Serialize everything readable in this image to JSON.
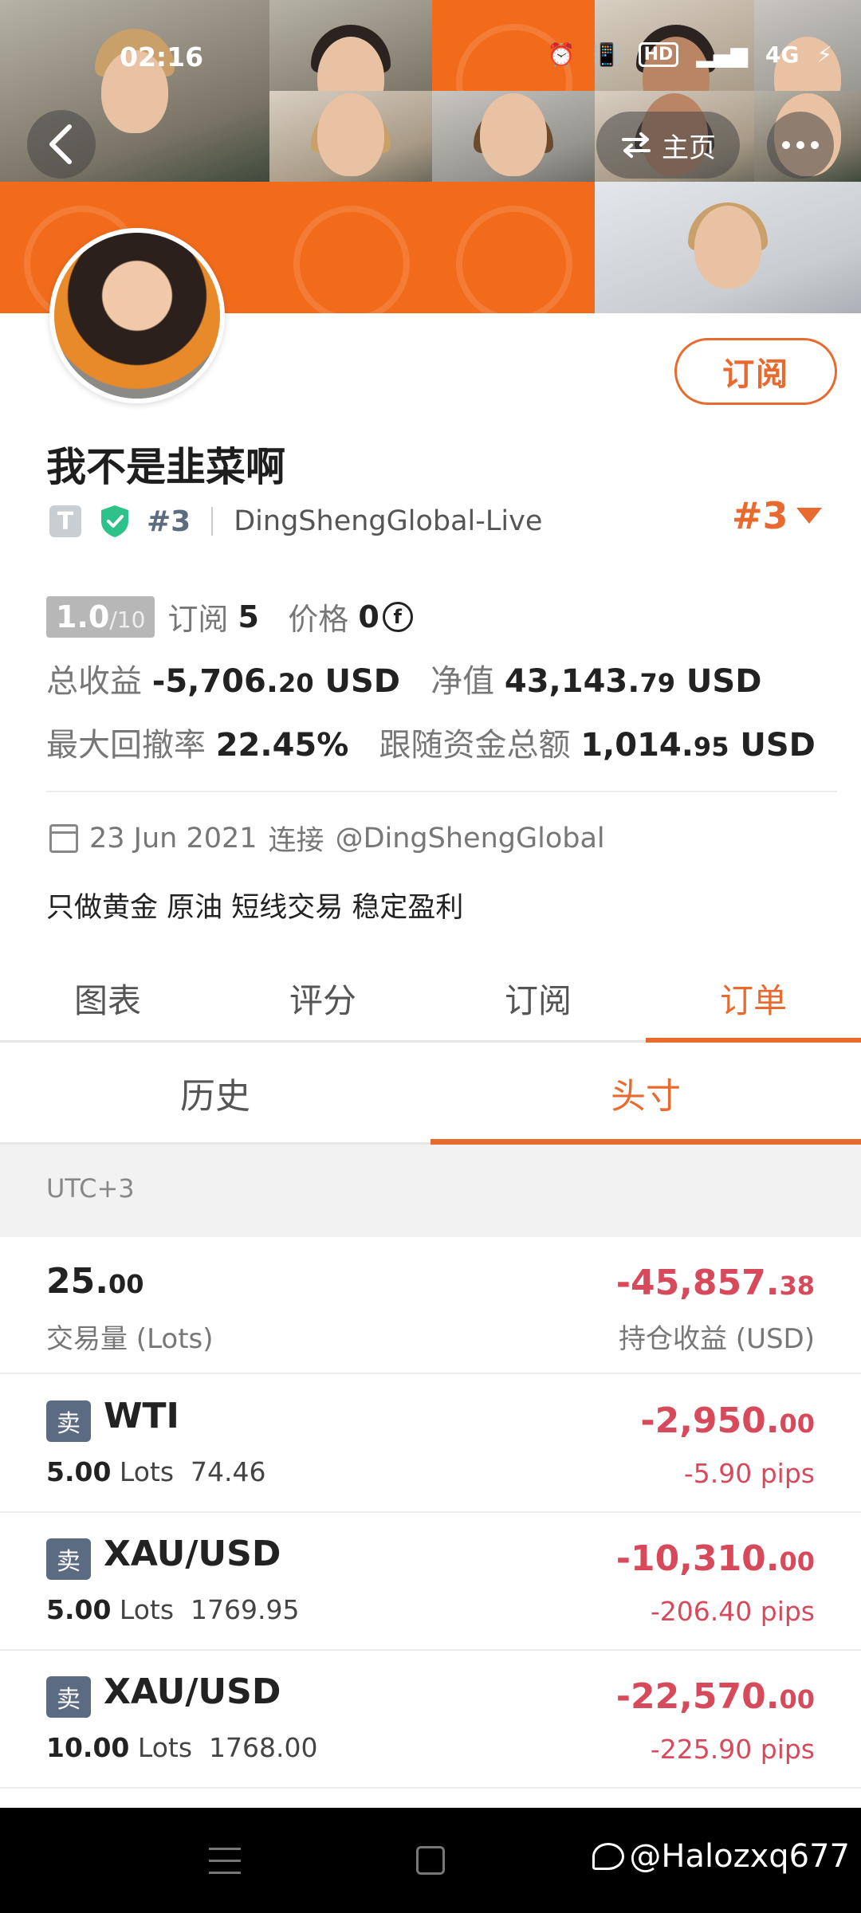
{
  "status_bar": {
    "time": "02:16",
    "network": "4G"
  },
  "header": {
    "home_label": "主页"
  },
  "profile": {
    "subscribe_label": "订阅",
    "name": "我不是韭菜啊",
    "badge_letter": "T",
    "rank": "#3",
    "broker": "DingShengGlobal-Live",
    "rank_right": "#3",
    "score": "1.0",
    "score_max": "/10",
    "subs_label": "订阅",
    "subs_value": "5",
    "price_label": "价格",
    "price_value": "0",
    "total_profit_label": "总收益",
    "total_profit_main": "-5,706.",
    "total_profit_dec": "20",
    "usd": "USD",
    "equity_label": "净值",
    "equity_main": "43,143.",
    "equity_dec": "79",
    "max_dd_label": "最大回撤率",
    "max_dd_value": "22.45%",
    "follow_label": "跟随资金总额",
    "follow_main": "1,014.",
    "follow_dec": "95",
    "connect_date": "23 Jun 2021",
    "connect_label": "连接",
    "connect_account": "@DingShengGlobal",
    "bio": "只做黄金 原油 短线交易 稳定盈利"
  },
  "tabs": [
    "图表",
    "评分",
    "订阅",
    "订单"
  ],
  "subtabs": [
    "历史",
    "头寸"
  ],
  "timezone": "UTC+3",
  "summary": {
    "volume_main": "25.",
    "volume_dec": "00",
    "volume_label": "交易量 (Lots)",
    "pnl_main": "-45,857.",
    "pnl_dec": "38",
    "pnl_label": "持仓收益 (USD)"
  },
  "orders": [
    {
      "side": "卖",
      "symbol": "WTI",
      "lots": "5.00",
      "lots_label": "Lots",
      "price": "74.46",
      "pnl_main": "-2,950.",
      "pnl_dec": "00",
      "pips": "-5.90 pips"
    },
    {
      "side": "卖",
      "symbol": "XAU/USD",
      "lots": "5.00",
      "lots_label": "Lots",
      "price": "1769.95",
      "pnl_main": "-10,310.",
      "pnl_dec": "00",
      "pips": "-206.40 pips"
    },
    {
      "side": "卖",
      "symbol": "XAU/USD",
      "lots": "10.00",
      "lots_label": "Lots",
      "price": "1768.00",
      "pnl_main": "-22,570.",
      "pnl_dec": "00",
      "pips": "-225.90 pips"
    }
  ],
  "watermark": "@Halozxq677",
  "colors": {
    "accent": "#e86a2e",
    "negative": "#d64a5c"
  }
}
